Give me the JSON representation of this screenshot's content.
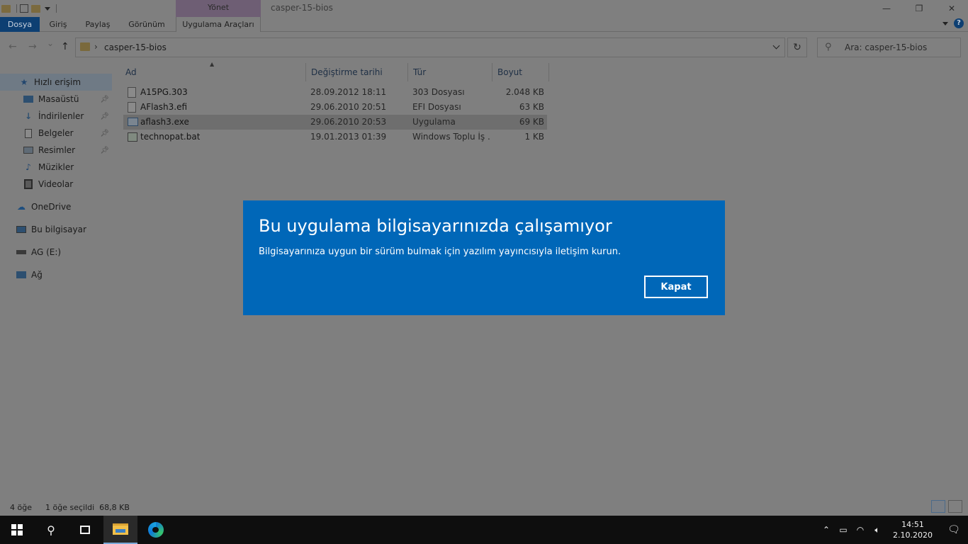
{
  "window": {
    "title": "casper-15-bios",
    "manage_tab": "Yönet",
    "controls": {
      "minimize": "—",
      "restore": "❐",
      "close": "✕"
    }
  },
  "ribbon": {
    "tabs": [
      "Dosya",
      "Giriş",
      "Paylaş",
      "Görünüm",
      "Uygulama Araçları"
    ],
    "help": "?"
  },
  "nav": {
    "back": "←",
    "forward": "→",
    "recent": "⌄",
    "up": "↑",
    "breadcrumb_sep": "›",
    "path": "casper-15-bios",
    "refresh": "↻",
    "search_placeholder": "Ara: casper-15-bios"
  },
  "sidebar": {
    "items": [
      {
        "label": "Hızlı erişim",
        "icon": "star-icon"
      },
      {
        "label": "Masaüstü",
        "icon": "desktop-icon",
        "pinned": true
      },
      {
        "label": "İndirilenler",
        "icon": "download-icon",
        "pinned": true
      },
      {
        "label": "Belgeler",
        "icon": "documents-icon",
        "pinned": true
      },
      {
        "label": "Resimler",
        "icon": "pictures-icon",
        "pinned": true
      },
      {
        "label": "Müzikler",
        "icon": "music-icon"
      },
      {
        "label": "Videolar",
        "icon": "videos-icon"
      },
      {
        "label": "OneDrive",
        "icon": "cloud-icon"
      },
      {
        "label": "Bu bilgisayar",
        "icon": "computer-icon"
      },
      {
        "label": "AG (E:)",
        "icon": "drive-icon"
      },
      {
        "label": "Ağ",
        "icon": "network-icon"
      }
    ]
  },
  "file_list": {
    "columns": [
      "Ad",
      "Değiştirme tarihi",
      "Tür",
      "Boyut"
    ],
    "rows": [
      {
        "name": "A15PG.303",
        "modified": "28.09.2012 18:11",
        "type": "303 Dosyası",
        "size": "2.048 KB"
      },
      {
        "name": "AFlash3.efi",
        "modified": "29.06.2010 20:51",
        "type": "EFI Dosyası",
        "size": "63 KB"
      },
      {
        "name": "aflash3.exe",
        "modified": "29.06.2010 20:53",
        "type": "Uygulama",
        "size": "69 KB"
      },
      {
        "name": "technopat.bat",
        "modified": "19.01.2013 01:39",
        "type": "Windows Toplu İş ...",
        "size": "1 KB"
      }
    ]
  },
  "status": {
    "count": "4 öğe",
    "selection": "1 öğe seçildi  68,8 KB"
  },
  "dialog": {
    "title": "Bu uygulama bilgisayarınızda çalışamıyor",
    "message": "Bilgisayarınıza uygun bir sürüm bulmak için yazılım yayıncısıyla iletişim kurun.",
    "close_button": "Kapat",
    "color": "#0067b8"
  },
  "taskbar": {
    "time": "14:51",
    "date": "2.10.2020"
  }
}
